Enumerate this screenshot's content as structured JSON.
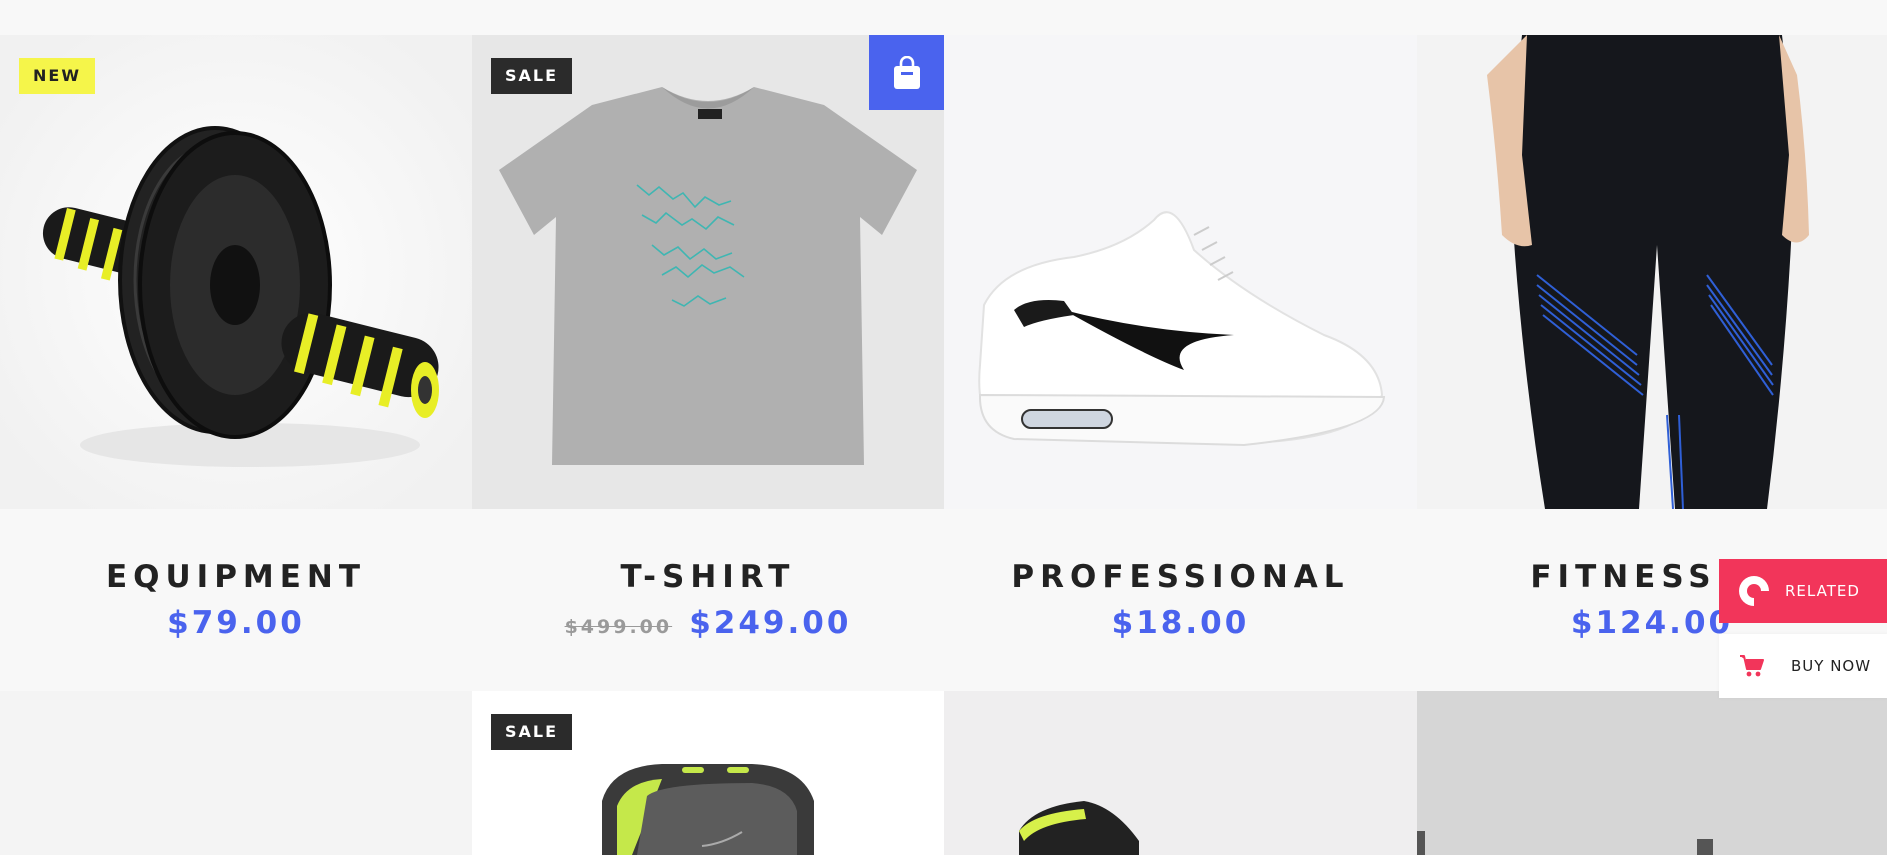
{
  "products": [
    {
      "name": "EQUIPMENT",
      "price": "$79.00",
      "badge": "NEW"
    },
    {
      "name": "T-SHIRT",
      "old_price": "$499.00",
      "price": "$249.00",
      "badge": "SALE"
    },
    {
      "name": "PROFESSIONAL",
      "price": "$18.00"
    },
    {
      "name": "FITNESS W",
      "price": "$124.00"
    }
  ],
  "row2": [
    {
      "badge": null
    },
    {
      "badge": "SALE"
    },
    {
      "badge": null
    },
    {
      "badge": null
    }
  ],
  "side": {
    "related_label": "RELATED",
    "buy_label": "BUY NOW"
  },
  "colors": {
    "accent": "#4a63ee",
    "new_badge": "#f5f54a",
    "sale_badge": "#2b2b2b",
    "related": "#f2355a"
  },
  "icons": {
    "bag": "shopping-bag-icon",
    "related": "related-logo-icon",
    "cart": "cart-icon"
  }
}
